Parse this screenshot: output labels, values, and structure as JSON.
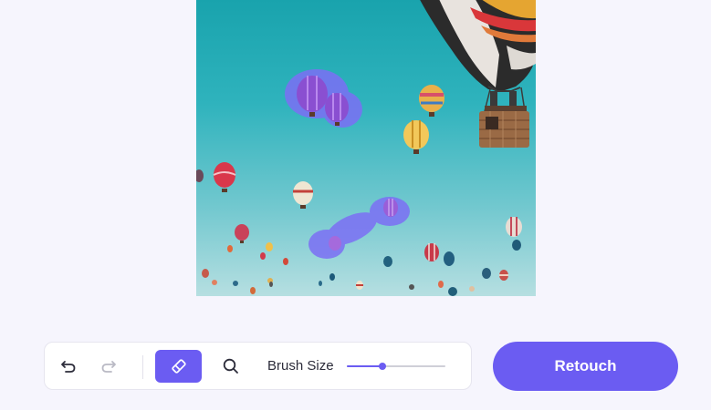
{
  "toolbar": {
    "undo_icon": "undo-icon",
    "redo_icon": "redo-icon",
    "eraser_icon": "eraser-icon",
    "zoom_icon": "search-icon",
    "brush_size_label": "Brush Size",
    "brush_size_level": 0.36
  },
  "actions": {
    "retouch_label": "Retouch"
  },
  "colors": {
    "accent": "#6b5cf2",
    "page_background": "#f6f5fd",
    "sky_top": "#19a3ad",
    "brush_overlay": "#7c6ff5",
    "disabled_icon": "#b9b9c4",
    "icon": "#2c2c3a"
  }
}
